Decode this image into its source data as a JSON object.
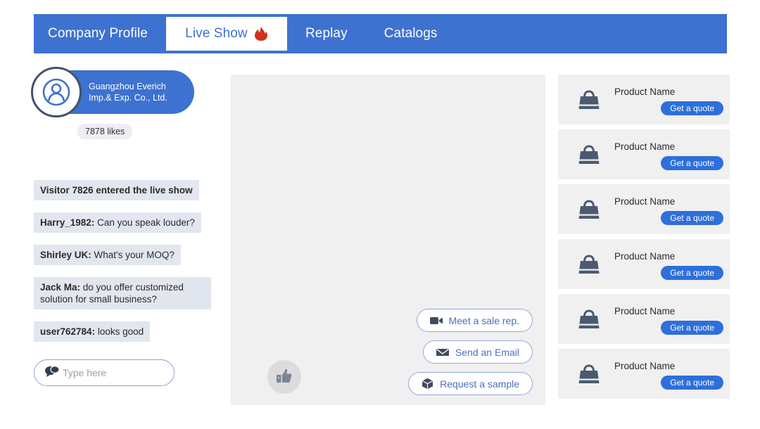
{
  "nav": {
    "tabs": [
      {
        "label": "Company Profile",
        "active": false,
        "icon": null
      },
      {
        "label": "Live Show",
        "active": true,
        "icon": "fire-icon"
      },
      {
        "label": "Replay",
        "active": false,
        "icon": null
      },
      {
        "label": "Catalogs",
        "active": false,
        "icon": null
      }
    ],
    "bar_color": "#3d72d0",
    "active_text_color": "#3d72d0"
  },
  "sidebar": {
    "avatar_icon": "user-avatar-icon",
    "company_name": "Guangzhou Everich\nImp.& Exp. Co., Ltd.",
    "likes_text": "7878 likes",
    "messages": [
      {
        "who": "Visitor 7826 entered the live show",
        "text": ""
      },
      {
        "who": "Harry_1982:",
        "text": " Can you speak louder?"
      },
      {
        "who": "Shirley UK:",
        "text": " What's your MOQ?"
      },
      {
        "who": " Jack Ma:",
        "text": " do you offer customized solution for small business?"
      },
      {
        "who": "user762784:",
        "text": " looks good"
      }
    ],
    "input": {
      "icon": "chat-bubble-icon",
      "placeholder": "Type here",
      "value": ""
    }
  },
  "stage": {
    "like_button_icon": "thumbs-up-icon",
    "ctas": [
      {
        "label": "Meet a sale rep.",
        "icon": "video-camera-icon"
      },
      {
        "label": "Send an Email",
        "icon": "envelope-icon"
      },
      {
        "label": "Request a sample",
        "icon": "box-icon"
      }
    ]
  },
  "products": {
    "quote_label": "Get a quote",
    "item_icon": "handbag-icon",
    "items": [
      {
        "name": "Product Name"
      },
      {
        "name": "Product Name"
      },
      {
        "name": "Product Name"
      },
      {
        "name": "Product Name"
      },
      {
        "name": "Product Name"
      },
      {
        "name": "Product Name"
      }
    ]
  },
  "colors": {
    "brand_blue": "#3d72d0",
    "quote_blue": "#2d6fdb",
    "chat_bubble": "#e2e6ee",
    "stage_gray": "#f0f0f0",
    "fire_red": "#d0321e"
  }
}
